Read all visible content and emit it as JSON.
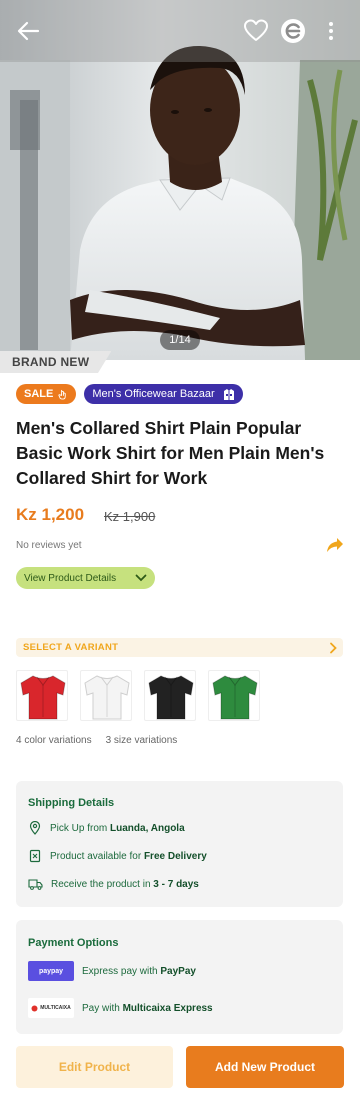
{
  "gallery": {
    "counter": "1/14",
    "condition_tag": "BRAND NEW"
  },
  "badges": {
    "sale": "SALE",
    "store": "Men's Officewear Bazaar"
  },
  "product": {
    "title": "Men's Collared Shirt Plain Popular Basic Work Shirt for Men Plain Men's Collared Shirt for Work",
    "price": "Kz 1,200",
    "old_price": "Kz 1,900",
    "reviews": "No reviews yet",
    "details_button": "View Product Details"
  },
  "variants": {
    "header": "SELECT A VARIANT",
    "swatches": [
      {
        "name": "red",
        "color": "#d9262c"
      },
      {
        "name": "white",
        "color": "#f4f4f4"
      },
      {
        "name": "black",
        "color": "#222222"
      },
      {
        "name": "green",
        "color": "#2e8b3e"
      }
    ],
    "color_count": "4 color variations",
    "size_count": "3 size variations"
  },
  "shipping": {
    "title": "Shipping Details",
    "pickup_prefix": "Pick Up from ",
    "pickup_place": "Luanda, Angola",
    "delivery_prefix": "Product available for ",
    "delivery_value": "Free Delivery",
    "receive_prefix": "Receive the product in ",
    "receive_value": "3 - 7 days"
  },
  "payment": {
    "title": "Payment Options",
    "paypay_logo": "paypay",
    "paypay_prefix": "Express pay with ",
    "paypay_name": "PayPay",
    "multicaixa_logo": "MULTICAIXA",
    "multicaixa_prefix": "Pay with ",
    "multicaixa_name": "Multicaixa Express"
  },
  "actions": {
    "edit": "Edit Product",
    "add": "Add New Product"
  },
  "colors": {
    "accent": "#e87c1e",
    "store_badge": "#3d2fa8",
    "green_text": "#1a6b3c"
  }
}
